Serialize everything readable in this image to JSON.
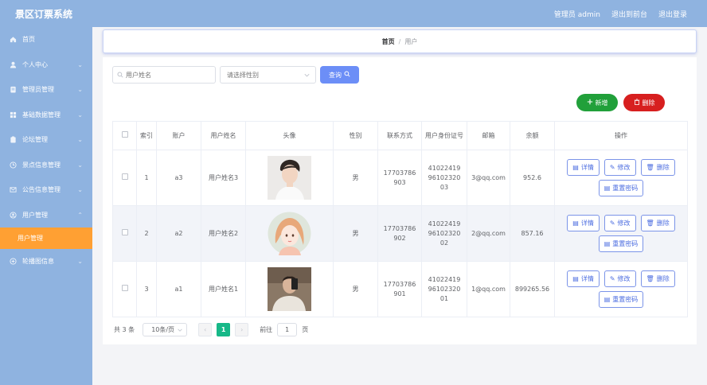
{
  "app": {
    "title": "景区订票系统"
  },
  "topnav": {
    "admin": "管理员 admin",
    "front": "退出到前台",
    "logout": "退出登录"
  },
  "sidebar": {
    "items": [
      {
        "label": "首页",
        "icon": "home-icon"
      },
      {
        "label": "个人中心",
        "icon": "user-icon"
      },
      {
        "label": "管理员管理",
        "icon": "admin-icon"
      },
      {
        "label": "基础数据管理",
        "icon": "grid-icon"
      },
      {
        "label": "论坛管理",
        "icon": "forum-icon"
      },
      {
        "label": "景点信息管理",
        "icon": "scenic-icon"
      },
      {
        "label": "公告信息管理",
        "icon": "mail-icon"
      },
      {
        "label": "用户管理",
        "icon": "users-icon"
      }
    ],
    "active_sub": "用户管理",
    "last_item": {
      "label": "轮播图信息",
      "icon": "carousel-icon"
    }
  },
  "breadcrumb": {
    "home": "首页",
    "sep": "/",
    "current": "用户"
  },
  "search": {
    "placeholder": "用户姓名",
    "gender_placeholder": "请选择性别",
    "query_label": "查询"
  },
  "actions": {
    "add_label": "新增",
    "delete_label": "删除"
  },
  "table": {
    "headers": [
      "索引",
      "账户",
      "用户姓名",
      "头像",
      "性别",
      "联系方式",
      "用户身份证号",
      "邮箱",
      "余额",
      "操作"
    ],
    "rows": [
      {
        "index": "1",
        "account": "a3",
        "name": "用户姓名3",
        "gender": "男",
        "phone": "17703786903",
        "id_card": "410224199610232003",
        "email": "3@qq.com",
        "balance": "952.6"
      },
      {
        "index": "2",
        "account": "a2",
        "name": "用户姓名2",
        "gender": "男",
        "phone": "17703786902",
        "id_card": "410224199610232002",
        "email": "2@qq.com",
        "balance": "857.16"
      },
      {
        "index": "3",
        "account": "a1",
        "name": "用户姓名1",
        "gender": "男",
        "phone": "17703786901",
        "id_card": "410224199610232001",
        "email": "1@qq.com",
        "balance": "899265.56"
      }
    ],
    "row_actions": {
      "detail": "详情",
      "edit": "修改",
      "delete": "删除",
      "reset": "重置密码"
    }
  },
  "pagination": {
    "total": "共 3 条",
    "page_size": "10条/页",
    "current_page": "1",
    "goto_label": "前往",
    "goto_value": "1",
    "page_suffix": "页"
  },
  "colors": {
    "header_bg": "#8fb3e0",
    "active_menu": "#ffa033",
    "primary": "#6c8ef7",
    "success": "#21a03a",
    "danger": "#d71f1f",
    "page_active": "#17b888"
  }
}
